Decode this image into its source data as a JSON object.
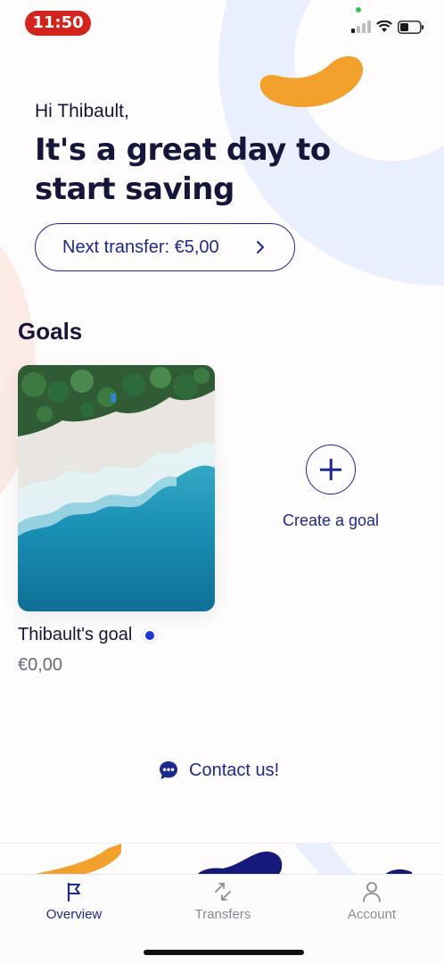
{
  "status_bar": {
    "time": "11:50",
    "icons": [
      "signal-icon",
      "wifi-icon",
      "battery-icon"
    ]
  },
  "greeting": "Hi Thibault,",
  "headline": "It's a great day to start saving",
  "next_transfer": {
    "label": "Next transfer: €5,00",
    "icon": "chevron-right-icon"
  },
  "goals": {
    "title": "Goals",
    "items": [
      {
        "name": "Thibault's goal",
        "amount": "€0,00",
        "dot_color": "#1f35d6"
      }
    ],
    "create_label": "Create a goal"
  },
  "contact": {
    "label": "Contact us!",
    "icon": "chat-bubble-icon"
  },
  "tabs": [
    {
      "label": "Overview",
      "icon": "flag-icon",
      "active": true
    },
    {
      "label": "Transfers",
      "icon": "arrows-swap-icon",
      "active": false
    },
    {
      "label": "Account",
      "icon": "person-icon",
      "active": false
    }
  ],
  "colors": {
    "accent": "#1d2a8c",
    "orange": "#f2a12c",
    "ring": "#e9effc",
    "peach": "#fbe7e0",
    "time_pill": "#d2241c"
  }
}
